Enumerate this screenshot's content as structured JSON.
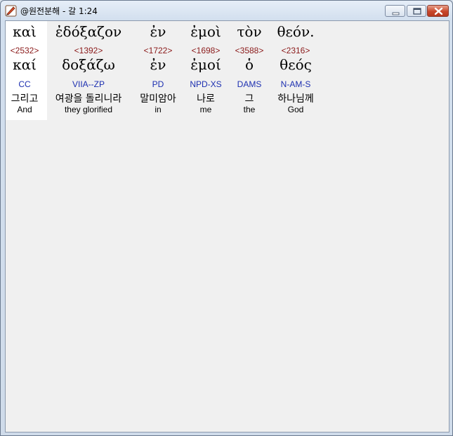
{
  "window": {
    "title": "@원전분해 - 갈 1:24",
    "controls": {
      "minimize": "minimize",
      "maximize": "maximize",
      "close": "close"
    }
  },
  "colors": {
    "strong": "#8b1a1a",
    "parse": "#1c2fb0",
    "highlight": "#ffffff"
  },
  "words": [
    {
      "greek": "καὶ",
      "strong": "<2532>",
      "lemma": "καί",
      "parse": "CC",
      "korean": "그리고",
      "english": "And"
    },
    {
      "greek": "ἐδόξαζον",
      "strong": "<1392>",
      "lemma": "δοξάζω",
      "parse": "VIIA--ZP",
      "korean": "여광을 돌리니라",
      "english": "they glorified"
    },
    {
      "greek": "ἐν",
      "strong": "<1722>",
      "lemma": "ἐν",
      "parse": "PD",
      "korean": "말미암아",
      "english": "in"
    },
    {
      "greek": "ἐμοὶ",
      "strong": "<1698>",
      "lemma": "ἐμοί",
      "parse": "NPD-XS",
      "korean": "나로",
      "english": "me"
    },
    {
      "greek": "τὸν",
      "strong": "<3588>",
      "lemma": "ὁ",
      "parse": "DAMS",
      "korean": "그",
      "english": "the"
    },
    {
      "greek": "θεόν.",
      "strong": "<2316>",
      "lemma": "θεός",
      "parse": "N-AM-S",
      "korean": "하나님께",
      "english": "God"
    }
  ]
}
